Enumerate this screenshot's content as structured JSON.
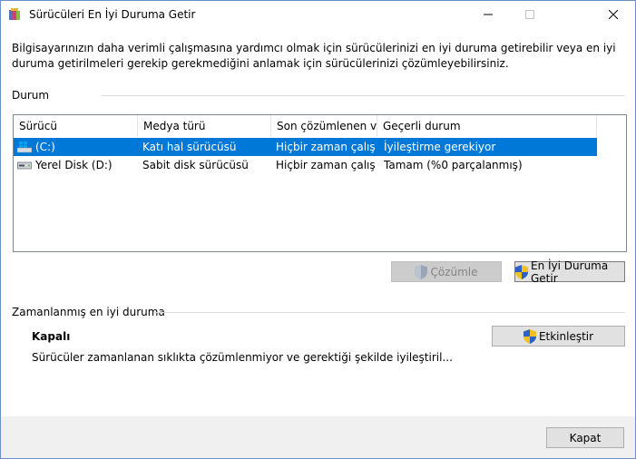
{
  "window": {
    "title": "Sürücüleri En İyi Duruma Getir",
    "controls": [
      "minimize-icon",
      "maximize-icon",
      "close-icon"
    ]
  },
  "description": "Bilgisayarınızın daha verimli çalışmasına yardımcı olmak için sürücülerinizi en iyi duruma getirebilir veya en iyi duruma getirilmeleri gerekip gerekmediğini anlamak için sürücülerinizi çözümleyebilirsiniz.",
  "status_group": {
    "label": "Durum",
    "columns": [
      "Sürücü",
      "Medya türü",
      "Son çözümlenen v...",
      "Geçerli durum"
    ],
    "rows": [
      {
        "drive": "(C:)",
        "media": "Katı hal sürücüsü",
        "last": "Hiçbir zaman çalış...",
        "state": "İyileştirme gerekiyor",
        "selected": true,
        "icon": "windows-drive-icon"
      },
      {
        "drive": "Yerel Disk (D:)",
        "media": "Sabit disk sürücüsü",
        "last": "Hiçbir zaman çalış...",
        "state": "Tamam (%0 parçalanmış)",
        "selected": false,
        "icon": "hard-drive-icon"
      }
    ],
    "analyze_label": "Çözümle",
    "optimize_label": "En İyi Duruma Getir"
  },
  "scheduled_group": {
    "label": "Zamanlanmış en iyi duruma",
    "status": "Kapalı",
    "detail": "Sürücüler zamanlanan sıklıkta çözümlenmiyor ve gerektiği şekilde iyileştiril...",
    "enable_label": "Etkinleştir"
  },
  "footer": {
    "close_label": "Kapat"
  },
  "colors": {
    "selection": "#0078d7",
    "button_face": "#e1e1e1",
    "footer_bg": "#f0f0f0"
  }
}
